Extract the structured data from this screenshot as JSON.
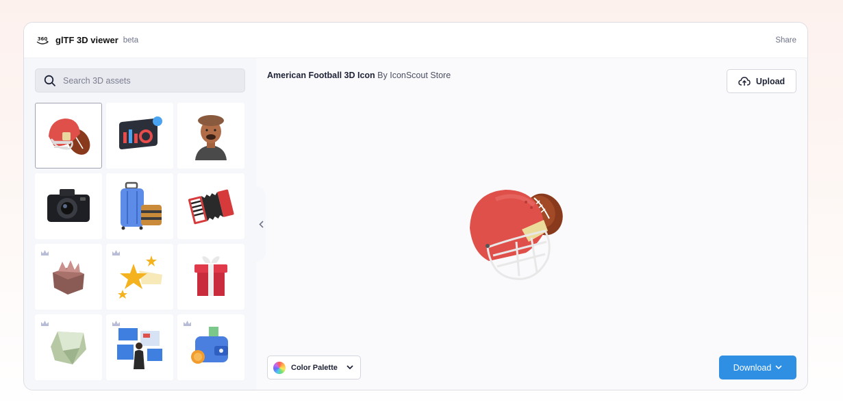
{
  "header": {
    "app_title": "glTF 3D viewer",
    "badge": "beta",
    "share_label": "Share",
    "logo_icon": "360-icon"
  },
  "search": {
    "placeholder": "Search 3D assets",
    "value": ""
  },
  "assets": [
    {
      "icon": "football-helmet-icon",
      "premium": false,
      "selected": true
    },
    {
      "icon": "analytics-dashboard-icon",
      "premium": false
    },
    {
      "icon": "avatar-man-beret-icon",
      "premium": false
    },
    {
      "icon": "camera-icon",
      "premium": false
    },
    {
      "icon": "luggage-icon",
      "premium": false
    },
    {
      "icon": "accordion-icon",
      "premium": false
    },
    {
      "icon": "gem-box-icon",
      "premium": true
    },
    {
      "icon": "shooting-stars-icon",
      "premium": true
    },
    {
      "icon": "gift-box-icon",
      "premium": true
    },
    {
      "icon": "green-shape-icon",
      "premium": true
    },
    {
      "icon": "presentation-board-icon",
      "premium": true
    },
    {
      "icon": "wallet-icon",
      "premium": true
    }
  ],
  "viewer": {
    "asset_name": "American Football 3D Icon",
    "by_text": "By IconScout Store",
    "upload_label": "Upload",
    "palette_label": "Color Palette",
    "download_label": "Download"
  },
  "colors": {
    "accent": "#2e8fe3",
    "helmet_red": "#e0504a",
    "football_brown": "#8a3a1c"
  }
}
